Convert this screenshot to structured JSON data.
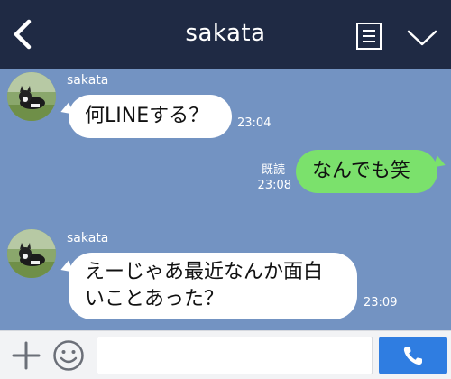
{
  "header": {
    "title": "sakata",
    "back_icon": "back-chevron-icon",
    "notes_icon": "notes-icon",
    "menu_icon": "chevron-down-icon"
  },
  "messages": [
    {
      "direction": "in",
      "sender": "sakata",
      "text": "何LINEする？",
      "time": "23:04"
    },
    {
      "direction": "out",
      "read": "既読",
      "text": "なんでも笑",
      "time": "23:08"
    },
    {
      "direction": "in",
      "sender": "sakata",
      "lines": [
        "えーじゃあ最近なんか面白",
        "いことあった？"
      ],
      "time": "23:09"
    }
  ],
  "input_bar": {
    "plus_icon": "plus-icon",
    "sticker_icon": "smiley-icon",
    "message_value": "",
    "message_placeholder": "",
    "call_icon": "phone-icon"
  },
  "colors": {
    "header_bg": "#1f2a44",
    "chat_bg": "#7393c2",
    "bubble_in": "#ffffff",
    "bubble_out": "#7be16c",
    "call_button": "#2f7de1"
  }
}
